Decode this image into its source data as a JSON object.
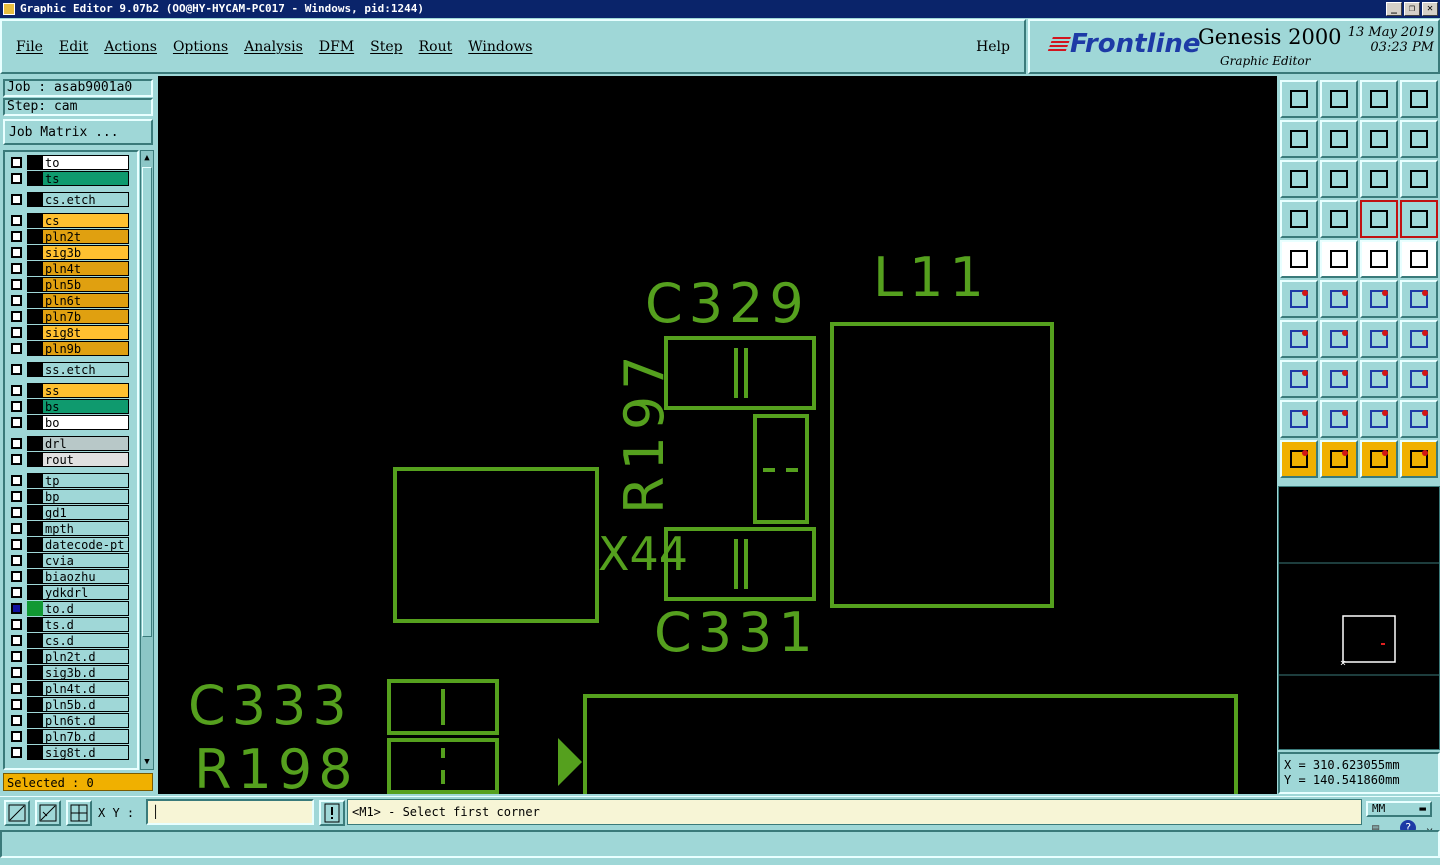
{
  "window": {
    "title": "Graphic Editor 9.07b2 (OO@HY-HYCAM-PC017 - Windows, pid:1244)"
  },
  "menu": {
    "items": [
      "File",
      "Edit",
      "Actions",
      "Options",
      "Analysis",
      "DFM",
      "Step",
      "Rout",
      "Windows"
    ],
    "help": "Help"
  },
  "brand": {
    "logo": "Frontline",
    "product": "Genesis 2000",
    "subtitle": "Graphic Editor",
    "date": "13 May 2019",
    "time": "03:23 PM"
  },
  "job": {
    "job": "Job : asab9001a0",
    "step": "Step: cam",
    "matrix_button": "Job Matrix ..."
  },
  "layers": [
    {
      "name": "to",
      "color": "#ffffff"
    },
    {
      "name": "ts",
      "color": "#0f9a6e"
    },
    {
      "name": "cs.etch",
      "color": "#9fd7d7"
    },
    {
      "name": "cs",
      "color": "#ffc030"
    },
    {
      "name": "pln2t",
      "color": "#e0a010"
    },
    {
      "name": "sig3b",
      "color": "#ffc030"
    },
    {
      "name": "pln4t",
      "color": "#e0a010"
    },
    {
      "name": "pln5b",
      "color": "#e0a010"
    },
    {
      "name": "pln6t",
      "color": "#e0a010"
    },
    {
      "name": "pln7b",
      "color": "#e0a010"
    },
    {
      "name": "sig8t",
      "color": "#ffc030"
    },
    {
      "name": "pln9b",
      "color": "#e0a010"
    },
    {
      "name": "ss.etch",
      "color": "#9fd7d7"
    },
    {
      "name": "ss",
      "color": "#ffc030"
    },
    {
      "name": "bs",
      "color": "#0f9a6e"
    },
    {
      "name": "bo",
      "color": "#ffffff"
    },
    {
      "name": "drl",
      "color": "#b8c8c8"
    },
    {
      "name": "rout",
      "color": "#e0e0e0"
    },
    {
      "name": "tp",
      "color": "#9fd7d7"
    },
    {
      "name": "bp",
      "color": "#9fd7d7"
    },
    {
      "name": "gd1",
      "color": "#9fd7d7"
    },
    {
      "name": "mpth",
      "color": "#9fd7d7"
    },
    {
      "name": "datecode-pt",
      "color": "#9fd7d7"
    },
    {
      "name": "cvia",
      "color": "#9fd7d7"
    },
    {
      "name": "biaozhu",
      "color": "#9fd7d7"
    },
    {
      "name": "ydkdrl",
      "color": "#9fd7d7"
    },
    {
      "name": "to.d",
      "color": "#9fd7d7",
      "active": true
    },
    {
      "name": "ts.d",
      "color": "#9fd7d7"
    },
    {
      "name": "cs.d",
      "color": "#9fd7d7"
    },
    {
      "name": "pln2t.d",
      "color": "#9fd7d7"
    },
    {
      "name": "sig3b.d",
      "color": "#9fd7d7"
    },
    {
      "name": "pln4t.d",
      "color": "#9fd7d7"
    },
    {
      "name": "pln5b.d",
      "color": "#9fd7d7"
    },
    {
      "name": "pln6t.d",
      "color": "#9fd7d7"
    },
    {
      "name": "pln7b.d",
      "color": "#9fd7d7"
    },
    {
      "name": "sig8t.d",
      "color": "#9fd7d7"
    }
  ],
  "selected": "Selected : 0",
  "canvas": {
    "color": "#55a01e",
    "labels": [
      "C329",
      "L11",
      "R197",
      "X44",
      "C331",
      "C333",
      "R198"
    ]
  },
  "coords": {
    "x": "X = 310.623055mm",
    "y": "Y = 140.541860mm"
  },
  "bottom": {
    "xy_label": "X Y :",
    "xy_value": "",
    "prompt": "<M1> - Select first corner",
    "units": "MM"
  }
}
